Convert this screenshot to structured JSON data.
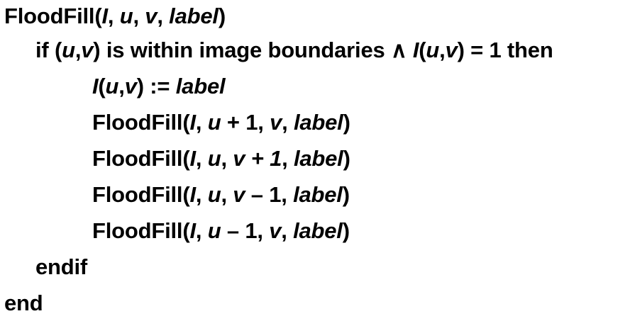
{
  "pseudocode": {
    "lines": [
      {
        "indent": 0,
        "segments": [
          {
            "t": "FloodFill(",
            "i": false
          },
          {
            "t": "I",
            "i": true
          },
          {
            "t": ", ",
            "i": false
          },
          {
            "t": "u",
            "i": true
          },
          {
            "t": ", ",
            "i": false
          },
          {
            "t": "v",
            "i": true
          },
          {
            "t": ", ",
            "i": false
          },
          {
            "t": "label",
            "i": true
          },
          {
            "t": ")",
            "i": false
          }
        ]
      },
      {
        "indent": 1,
        "segments": [
          {
            "t": "if (",
            "i": false
          },
          {
            "t": "u",
            "i": true
          },
          {
            "t": ",",
            "i": false
          },
          {
            "t": "v",
            "i": true
          },
          {
            "t": ") is within image boundaries ∧ ",
            "i": false
          },
          {
            "t": "I",
            "i": true
          },
          {
            "t": "(",
            "i": false
          },
          {
            "t": "u",
            "i": true
          },
          {
            "t": ",",
            "i": false
          },
          {
            "t": "v",
            "i": true
          },
          {
            "t": ") = 1 then",
            "i": false
          }
        ]
      },
      {
        "indent": 2,
        "segments": [
          {
            "t": "I",
            "i": true
          },
          {
            "t": "(",
            "i": false
          },
          {
            "t": "u",
            "i": true
          },
          {
            "t": ",",
            "i": false
          },
          {
            "t": "v",
            "i": true
          },
          {
            "t": ") := ",
            "i": false
          },
          {
            "t": "label",
            "i": true
          }
        ]
      },
      {
        "indent": 2,
        "segments": [
          {
            "t": "FloodFill(",
            "i": false
          },
          {
            "t": "I",
            "i": true
          },
          {
            "t": ", ",
            "i": false
          },
          {
            "t": "u",
            "i": true
          },
          {
            "t": " + 1, ",
            "i": false
          },
          {
            "t": "v",
            "i": true
          },
          {
            "t": ", ",
            "i": false
          },
          {
            "t": "label",
            "i": true
          },
          {
            "t": ")",
            "i": false
          }
        ]
      },
      {
        "indent": 2,
        "segments": [
          {
            "t": "FloodFill(",
            "i": false
          },
          {
            "t": "I",
            "i": true
          },
          {
            "t": ", ",
            "i": false
          },
          {
            "t": "u",
            "i": true
          },
          {
            "t": ", ",
            "i": false
          },
          {
            "t": "v + 1",
            "i": true
          },
          {
            "t": ", ",
            "i": false
          },
          {
            "t": "label",
            "i": true
          },
          {
            "t": ")",
            "i": false
          }
        ]
      },
      {
        "indent": 2,
        "segments": [
          {
            "t": "FloodFill(",
            "i": false
          },
          {
            "t": "I",
            "i": true
          },
          {
            "t": ", ",
            "i": false
          },
          {
            "t": "u",
            "i": true
          },
          {
            "t": ", ",
            "i": false
          },
          {
            "t": "v",
            "i": true
          },
          {
            "t": " – 1, ",
            "i": false
          },
          {
            "t": "label",
            "i": true
          },
          {
            "t": ")",
            "i": false
          }
        ]
      },
      {
        "indent": 2,
        "segments": [
          {
            "t": "FloodFill(",
            "i": false
          },
          {
            "t": "I",
            "i": true
          },
          {
            "t": ", ",
            "i": false
          },
          {
            "t": "u",
            "i": true
          },
          {
            "t": " – 1, ",
            "i": false
          },
          {
            "t": "v",
            "i": true
          },
          {
            "t": ", ",
            "i": false
          },
          {
            "t": "label",
            "i": true
          },
          {
            "t": ")",
            "i": false
          }
        ]
      },
      {
        "indent": 1,
        "segments": [
          {
            "t": "endif",
            "i": false
          }
        ]
      },
      {
        "indent": 0,
        "segments": [
          {
            "t": "end",
            "i": false
          }
        ]
      }
    ]
  }
}
